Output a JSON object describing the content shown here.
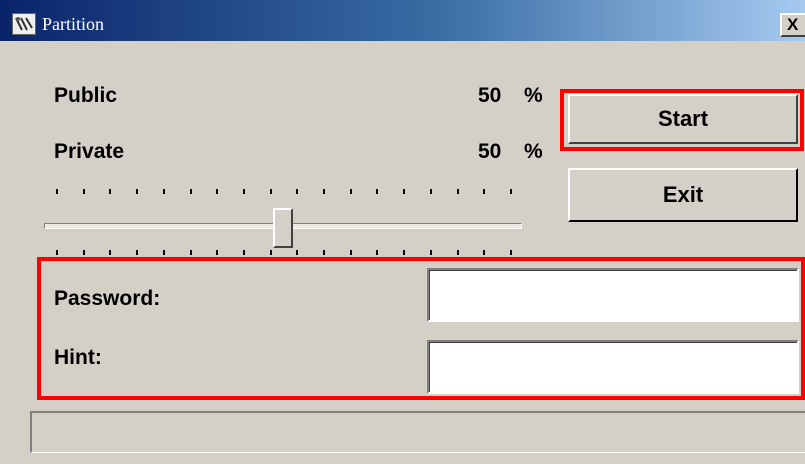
{
  "window": {
    "title": "Partition",
    "close_glyph": "X"
  },
  "distribution": {
    "public": {
      "label": "Public",
      "value": "50",
      "unit": "%"
    },
    "private": {
      "label": "Private",
      "value": "50",
      "unit": "%"
    },
    "slider": {
      "value_percent": 50,
      "tick_count": 18
    }
  },
  "buttons": {
    "start_label": "Start",
    "exit_label": "Exit"
  },
  "credentials": {
    "password": {
      "label": "Password:",
      "value": ""
    },
    "hint": {
      "label": "Hint:",
      "value": ""
    }
  },
  "status": {
    "text": ""
  },
  "highlight_color": "#ff0000"
}
